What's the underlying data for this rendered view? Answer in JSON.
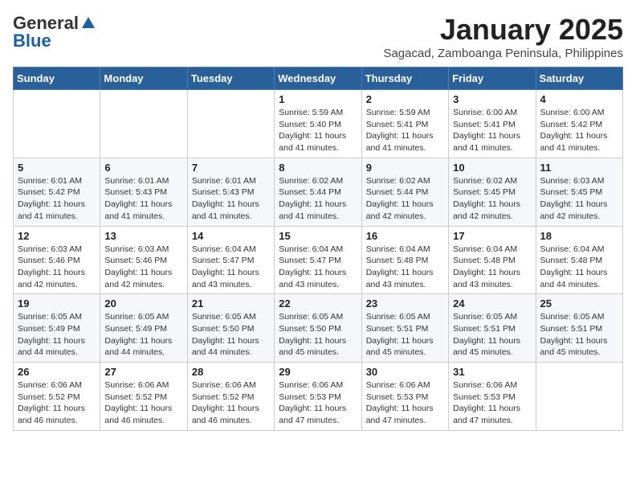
{
  "logo": {
    "general": "General",
    "blue": "Blue"
  },
  "title": "January 2025",
  "subtitle": "Sagacad, Zamboanga Peninsula, Philippines",
  "weekdays": [
    "Sunday",
    "Monday",
    "Tuesday",
    "Wednesday",
    "Thursday",
    "Friday",
    "Saturday"
  ],
  "weeks": [
    [
      {
        "day": "",
        "info": ""
      },
      {
        "day": "",
        "info": ""
      },
      {
        "day": "",
        "info": ""
      },
      {
        "day": "1",
        "sunrise": "Sunrise: 5:59 AM",
        "sunset": "Sunset: 5:40 PM",
        "daylight": "Daylight: 11 hours and 41 minutes."
      },
      {
        "day": "2",
        "sunrise": "Sunrise: 5:59 AM",
        "sunset": "Sunset: 5:41 PM",
        "daylight": "Daylight: 11 hours and 41 minutes."
      },
      {
        "day": "3",
        "sunrise": "Sunrise: 6:00 AM",
        "sunset": "Sunset: 5:41 PM",
        "daylight": "Daylight: 11 hours and 41 minutes."
      },
      {
        "day": "4",
        "sunrise": "Sunrise: 6:00 AM",
        "sunset": "Sunset: 5:42 PM",
        "daylight": "Daylight: 11 hours and 41 minutes."
      }
    ],
    [
      {
        "day": "5",
        "sunrise": "Sunrise: 6:01 AM",
        "sunset": "Sunset: 5:42 PM",
        "daylight": "Daylight: 11 hours and 41 minutes."
      },
      {
        "day": "6",
        "sunrise": "Sunrise: 6:01 AM",
        "sunset": "Sunset: 5:43 PM",
        "daylight": "Daylight: 11 hours and 41 minutes."
      },
      {
        "day": "7",
        "sunrise": "Sunrise: 6:01 AM",
        "sunset": "Sunset: 5:43 PM",
        "daylight": "Daylight: 11 hours and 41 minutes."
      },
      {
        "day": "8",
        "sunrise": "Sunrise: 6:02 AM",
        "sunset": "Sunset: 5:44 PM",
        "daylight": "Daylight: 11 hours and 41 minutes."
      },
      {
        "day": "9",
        "sunrise": "Sunrise: 6:02 AM",
        "sunset": "Sunset: 5:44 PM",
        "daylight": "Daylight: 11 hours and 42 minutes."
      },
      {
        "day": "10",
        "sunrise": "Sunrise: 6:02 AM",
        "sunset": "Sunset: 5:45 PM",
        "daylight": "Daylight: 11 hours and 42 minutes."
      },
      {
        "day": "11",
        "sunrise": "Sunrise: 6:03 AM",
        "sunset": "Sunset: 5:45 PM",
        "daylight": "Daylight: 11 hours and 42 minutes."
      }
    ],
    [
      {
        "day": "12",
        "sunrise": "Sunrise: 6:03 AM",
        "sunset": "Sunset: 5:46 PM",
        "daylight": "Daylight: 11 hours and 42 minutes."
      },
      {
        "day": "13",
        "sunrise": "Sunrise: 6:03 AM",
        "sunset": "Sunset: 5:46 PM",
        "daylight": "Daylight: 11 hours and 42 minutes."
      },
      {
        "day": "14",
        "sunrise": "Sunrise: 6:04 AM",
        "sunset": "Sunset: 5:47 PM",
        "daylight": "Daylight: 11 hours and 43 minutes."
      },
      {
        "day": "15",
        "sunrise": "Sunrise: 6:04 AM",
        "sunset": "Sunset: 5:47 PM",
        "daylight": "Daylight: 11 hours and 43 minutes."
      },
      {
        "day": "16",
        "sunrise": "Sunrise: 6:04 AM",
        "sunset": "Sunset: 5:48 PM",
        "daylight": "Daylight: 11 hours and 43 minutes."
      },
      {
        "day": "17",
        "sunrise": "Sunrise: 6:04 AM",
        "sunset": "Sunset: 5:48 PM",
        "daylight": "Daylight: 11 hours and 43 minutes."
      },
      {
        "day": "18",
        "sunrise": "Sunrise: 6:04 AM",
        "sunset": "Sunset: 5:48 PM",
        "daylight": "Daylight: 11 hours and 44 minutes."
      }
    ],
    [
      {
        "day": "19",
        "sunrise": "Sunrise: 6:05 AM",
        "sunset": "Sunset: 5:49 PM",
        "daylight": "Daylight: 11 hours and 44 minutes."
      },
      {
        "day": "20",
        "sunrise": "Sunrise: 6:05 AM",
        "sunset": "Sunset: 5:49 PM",
        "daylight": "Daylight: 11 hours and 44 minutes."
      },
      {
        "day": "21",
        "sunrise": "Sunrise: 6:05 AM",
        "sunset": "Sunset: 5:50 PM",
        "daylight": "Daylight: 11 hours and 44 minutes."
      },
      {
        "day": "22",
        "sunrise": "Sunrise: 6:05 AM",
        "sunset": "Sunset: 5:50 PM",
        "daylight": "Daylight: 11 hours and 45 minutes."
      },
      {
        "day": "23",
        "sunrise": "Sunrise: 6:05 AM",
        "sunset": "Sunset: 5:51 PM",
        "daylight": "Daylight: 11 hours and 45 minutes."
      },
      {
        "day": "24",
        "sunrise": "Sunrise: 6:05 AM",
        "sunset": "Sunset: 5:51 PM",
        "daylight": "Daylight: 11 hours and 45 minutes."
      },
      {
        "day": "25",
        "sunrise": "Sunrise: 6:05 AM",
        "sunset": "Sunset: 5:51 PM",
        "daylight": "Daylight: 11 hours and 45 minutes."
      }
    ],
    [
      {
        "day": "26",
        "sunrise": "Sunrise: 6:06 AM",
        "sunset": "Sunset: 5:52 PM",
        "daylight": "Daylight: 11 hours and 46 minutes."
      },
      {
        "day": "27",
        "sunrise": "Sunrise: 6:06 AM",
        "sunset": "Sunset: 5:52 PM",
        "daylight": "Daylight: 11 hours and 46 minutes."
      },
      {
        "day": "28",
        "sunrise": "Sunrise: 6:06 AM",
        "sunset": "Sunset: 5:52 PM",
        "daylight": "Daylight: 11 hours and 46 minutes."
      },
      {
        "day": "29",
        "sunrise": "Sunrise: 6:06 AM",
        "sunset": "Sunset: 5:53 PM",
        "daylight": "Daylight: 11 hours and 47 minutes."
      },
      {
        "day": "30",
        "sunrise": "Sunrise: 6:06 AM",
        "sunset": "Sunset: 5:53 PM",
        "daylight": "Daylight: 11 hours and 47 minutes."
      },
      {
        "day": "31",
        "sunrise": "Sunrise: 6:06 AM",
        "sunset": "Sunset: 5:53 PM",
        "daylight": "Daylight: 11 hours and 47 minutes."
      },
      {
        "day": "",
        "info": ""
      }
    ]
  ]
}
